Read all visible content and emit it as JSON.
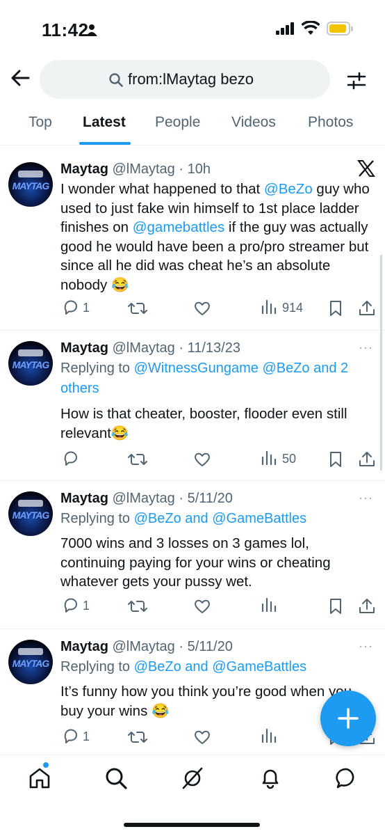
{
  "status_bar": {
    "time": "11:42"
  },
  "search": {
    "query": "from:lMaytag bezo"
  },
  "tabs": [
    "Top",
    "Latest",
    "People",
    "Videos",
    "Photos"
  ],
  "active_tab": "Latest",
  "posts": [
    {
      "name": "Maytag",
      "handle_time": "@lMaytag · 10h",
      "text_parts": [
        "I wonder what happened to that ",
        "@BeZo",
        " guy who used to just fake win himself to 1st place ladder finishes on ",
        "@gamebattles",
        " if the guy was actually good he would have been a pro/pro streamer but since all he did was cheat he’s an absolute nobody 😂"
      ],
      "replies": "1",
      "views": "914"
    },
    {
      "name": "Maytag",
      "handle_time": "@lMaytag · 11/13/23",
      "replying_prefix": "Replying to ",
      "replying_to": "@WitnessGungame @BeZo and 2 others",
      "text": "How is that cheater, booster, flooder even still relevant😂",
      "replies": "",
      "views": "50"
    },
    {
      "name": "Maytag",
      "handle_time": "@lMaytag · 5/11/20",
      "replying_prefix": "Replying to ",
      "replying_to": "@BeZo and @GameBattles",
      "text": "7000 wins and 3 losses on 3 games lol, continuing paying for your wins or cheating whatever gets your pussy wet.",
      "replies": "1",
      "views": ""
    },
    {
      "name": "Maytag",
      "handle_time": "@lMaytag · 5/11/20",
      "replying_prefix": "Replying to ",
      "replying_to": "@BeZo and @GameBattles",
      "text": "It’s funny how you think you’re good when you buy your wins 😂",
      "replies": "1",
      "views": ""
    }
  ],
  "avatar_text": "MAYTAG",
  "more_label": "···",
  "icons": [
    "back-arrow-icon",
    "search-icon",
    "filter-icon",
    "x-logo-icon",
    "reply-icon",
    "retweet-icon",
    "like-icon",
    "views-icon",
    "bookmark-icon",
    "share-icon",
    "compose-icon",
    "home-icon",
    "explore-icon",
    "grok-icon",
    "notifications-icon",
    "messages-icon"
  ],
  "colors": {
    "accent": "#1d9bf0",
    "text": "#0f1419",
    "muted": "#536471"
  }
}
